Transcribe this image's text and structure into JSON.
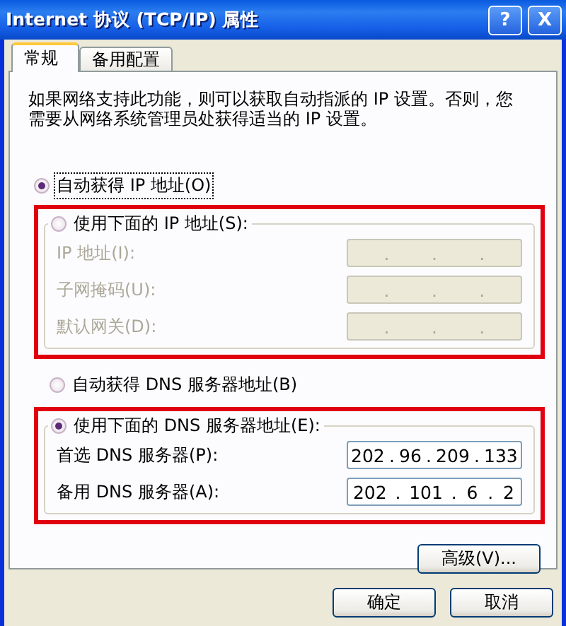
{
  "window": {
    "title": "Internet 协议 (TCP/IP) 属性",
    "help_button": "?",
    "close_button": "X"
  },
  "tabs": [
    {
      "label": "常规",
      "selected": true
    },
    {
      "label": "备用配置",
      "selected": false
    }
  ],
  "description": "如果网络支持此功能，则可以获取自动指派的 IP 设置。否则，您需要从网络系统管理员处获得适当的 IP 设置。",
  "separator": ".",
  "ip_auto": {
    "label": "自动获得 IP 地址(O)",
    "selected": true
  },
  "ip_manual": {
    "label": "使用下面的 IP 地址(S):",
    "selected": false,
    "highlighted": true,
    "disabled": true,
    "fields": [
      {
        "label": "IP 地址(I):"
      },
      {
        "label": "子网掩码(U):"
      },
      {
        "label": "默认网关(D):"
      }
    ]
  },
  "dns_auto": {
    "label": "自动获得 DNS 服务器地址(B)",
    "selected": false
  },
  "dns_manual": {
    "label": "使用下面的 DNS 服务器地址(E):",
    "selected": true,
    "highlighted": true,
    "disabled": false,
    "fields": [
      {
        "label": "首选 DNS 服务器(P):",
        "octets": [
          "202",
          "96",
          "209",
          "133"
        ]
      },
      {
        "label": "备用 DNS 服务器(A):",
        "octets": [
          "202",
          "101",
          "6",
          "2"
        ]
      }
    ]
  },
  "advanced_button": "高级(V)...",
  "buttons": [
    "确定",
    "取消"
  ]
}
